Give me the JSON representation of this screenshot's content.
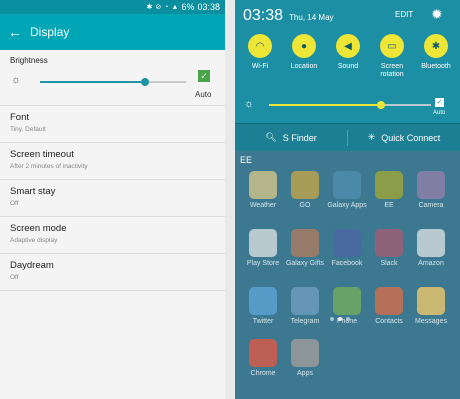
{
  "left": {
    "status": {
      "icons": [
        "bluetooth",
        "no-sound",
        "wifi",
        "signal"
      ],
      "battery": "6%",
      "time": "03:38"
    },
    "appbar": {
      "back": "back-icon",
      "title": "Display"
    },
    "brightness": {
      "label": "Brightness",
      "level": 0.72,
      "auto_label": "Auto",
      "auto_checked": true
    },
    "items": [
      {
        "title": "Font",
        "subtitle": "Tiny, Default"
      },
      {
        "title": "Screen timeout",
        "subtitle": "After 2 minutes of inactivity"
      },
      {
        "title": "Smart stay",
        "subtitle": "Off"
      },
      {
        "title": "Screen mode",
        "subtitle": "Adaptive display"
      },
      {
        "title": "Daydream",
        "subtitle": "Off"
      }
    ]
  },
  "right": {
    "time": "03:38",
    "date": "Thu, 14 May",
    "edit": "EDIT",
    "toggles": [
      {
        "label": "Wi-Fi",
        "icon": "wifi-icon"
      },
      {
        "label": "Location",
        "icon": "location-icon"
      },
      {
        "label": "Sound",
        "icon": "sound-icon"
      },
      {
        "label": "Screen\nrotation",
        "icon": "rotation-icon"
      },
      {
        "label": "Bluetooth",
        "icon": "bluetooth-icon"
      }
    ],
    "brightness": {
      "level": 0.69,
      "auto_label": "Auto",
      "auto_checked": true
    },
    "sfinder": "S Finder",
    "quick_connect": "Quick Connect",
    "carrier": "EE",
    "home_apps": [
      {
        "label": "Weather",
        "color": "#c9c08b"
      },
      {
        "label": "GO",
        "color": "#b9a24e"
      },
      {
        "label": "Galaxy Apps",
        "color": "#4e8cae"
      },
      {
        "label": "EE",
        "color": "#9aa33d"
      },
      {
        "label": "Camera",
        "color": "#8d7fa9"
      },
      {
        "label": "Play Store",
        "color": "#cfd7dc"
      },
      {
        "label": "Galaxy Gifts",
        "color": "#a77b64"
      },
      {
        "label": "Facebook",
        "color": "#4a67a4"
      },
      {
        "label": "Slack",
        "color": "#9c5e74"
      },
      {
        "label": "Amazon",
        "color": "#cfd7dc"
      },
      {
        "label": "Twitter",
        "color": "#5aa2d4"
      },
      {
        "label": "Telegram",
        "color": "#6c9bbd"
      },
      {
        "label": "Phone",
        "color": "#6fa961"
      },
      {
        "label": "Contacts",
        "color": "#c96f4f"
      },
      {
        "label": "Messages",
        "color": "#e3c26c"
      },
      {
        "label": "Chrome",
        "color": "#d45b4a"
      },
      {
        "label": "Apps",
        "color": "#9a9a9a"
      }
    ]
  }
}
